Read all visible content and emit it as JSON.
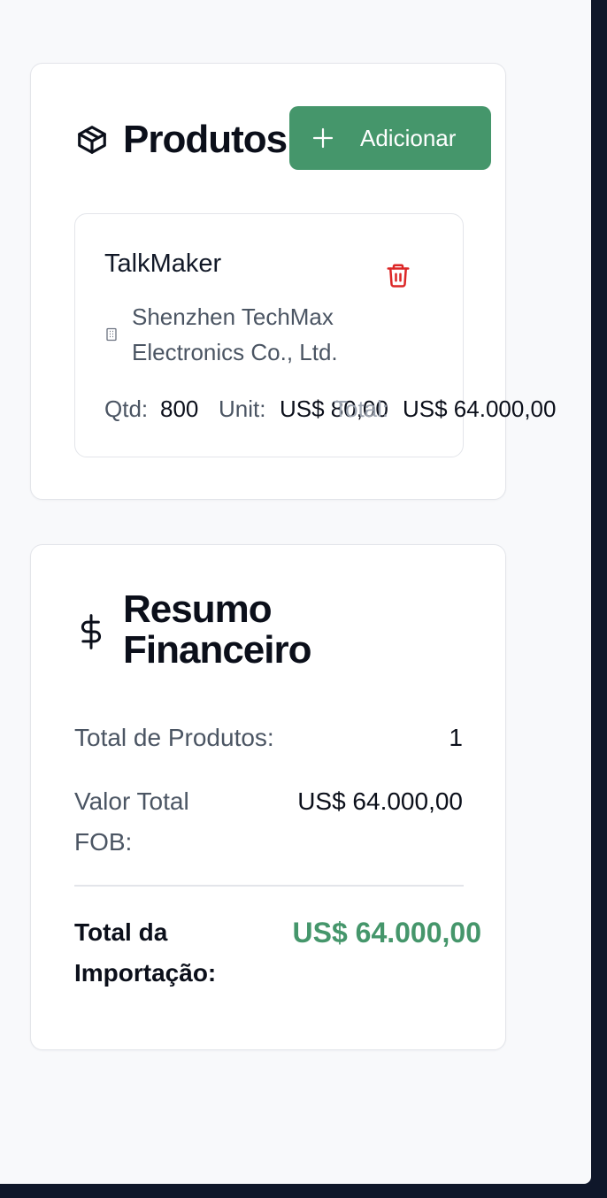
{
  "products_card": {
    "title": "Produtos",
    "add_button_label": "Adicionar",
    "items": [
      {
        "name": "TalkMaker",
        "supplier": "Shenzhen TechMax Electronics Co., Ltd.",
        "qty_label": "Qtd:",
        "qty_value": "800",
        "unit_label": "Unit:",
        "unit_value": "US$ 80,00",
        "total_label": "Total:",
        "total_value": "US$ 64.000,00"
      }
    ]
  },
  "summary_card": {
    "title": "Resumo Financeiro",
    "rows": [
      {
        "label": "Total de Produtos:",
        "value": "1"
      },
      {
        "label": "Valor Total FOB:",
        "value": "US$ 64.000,00"
      }
    ],
    "total_label": "Total da Importação:",
    "total_value": "US$ 64.000,00"
  },
  "colors": {
    "accent_green": "#45966b",
    "delete_red": "#dc2626",
    "background": "#f8f9fb",
    "frame_dark": "#0f172a"
  },
  "icons": {
    "products": "package-icon",
    "add": "plus-icon",
    "delete": "trash-icon",
    "supplier": "building-icon",
    "summary": "dollar-icon"
  }
}
